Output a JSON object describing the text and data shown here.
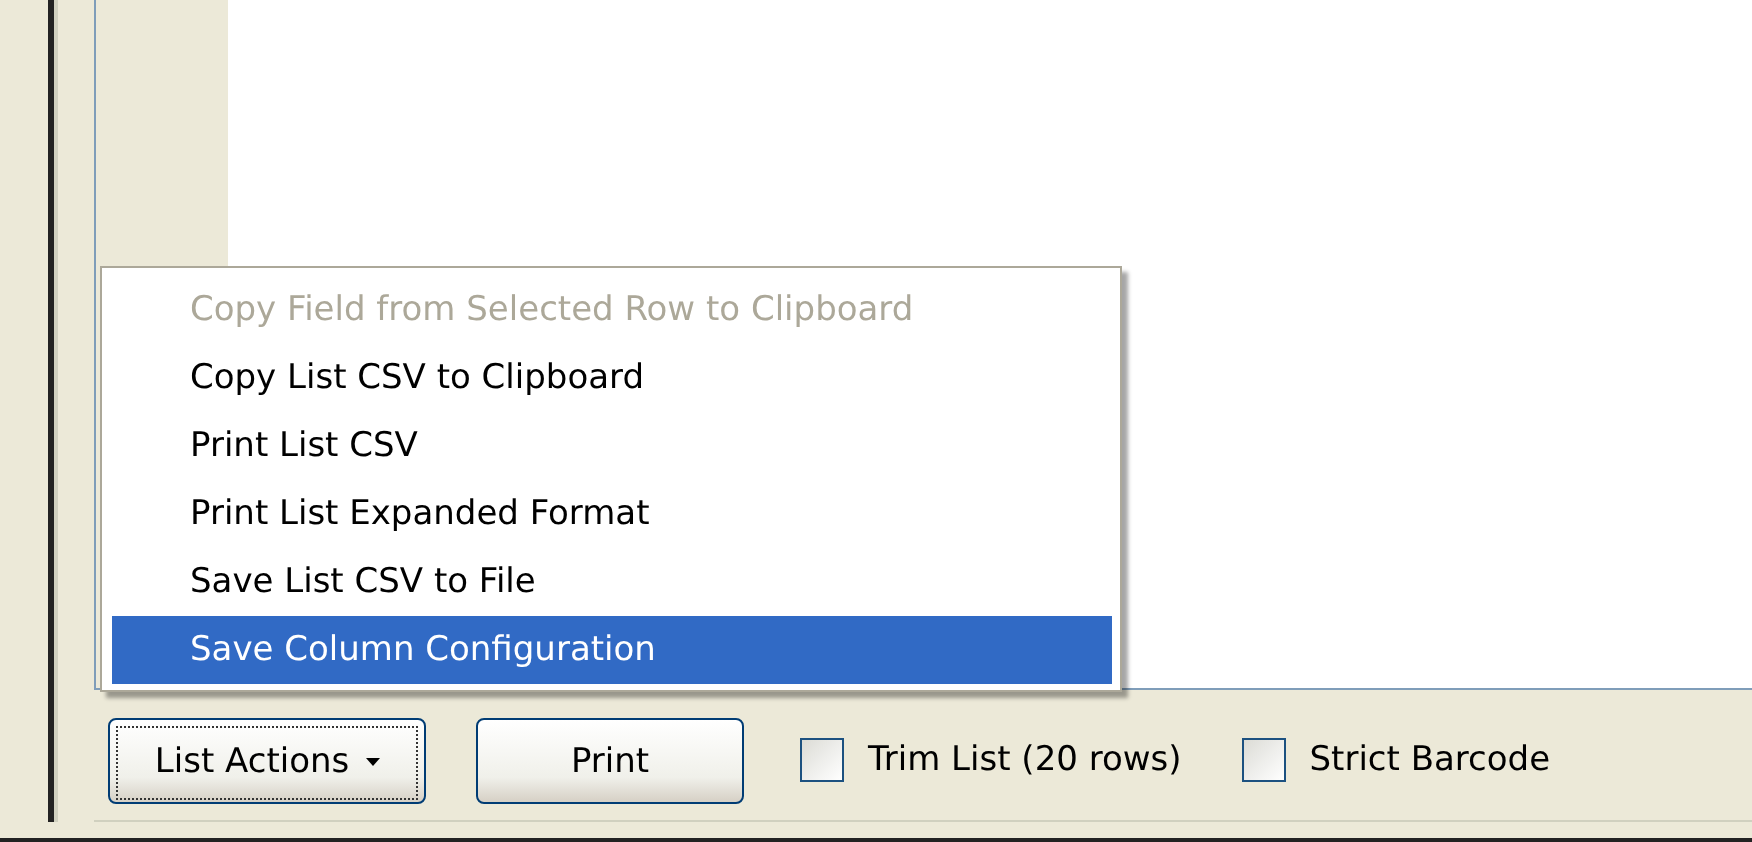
{
  "menu": {
    "items": [
      {
        "label": "Copy Field from Selected Row to Clipboard",
        "disabled": true,
        "selected": false
      },
      {
        "label": "Copy List CSV to Clipboard",
        "disabled": false,
        "selected": false
      },
      {
        "label": "Print List CSV",
        "disabled": false,
        "selected": false
      },
      {
        "label": "Print List Expanded Format",
        "disabled": false,
        "selected": false
      },
      {
        "label": "Save List CSV to File",
        "disabled": false,
        "selected": false
      },
      {
        "label": "Save Column Configuration",
        "disabled": false,
        "selected": true
      }
    ]
  },
  "toolbar": {
    "buttons": [
      {
        "label": "List Actions",
        "dropdown": true,
        "focused": true
      },
      {
        "label": "Print",
        "dropdown": false,
        "focused": false
      }
    ],
    "checkboxes": [
      {
        "label": "Trim List (20 rows)",
        "checked": false
      },
      {
        "label": "Strict Barcode",
        "checked": false
      }
    ]
  }
}
